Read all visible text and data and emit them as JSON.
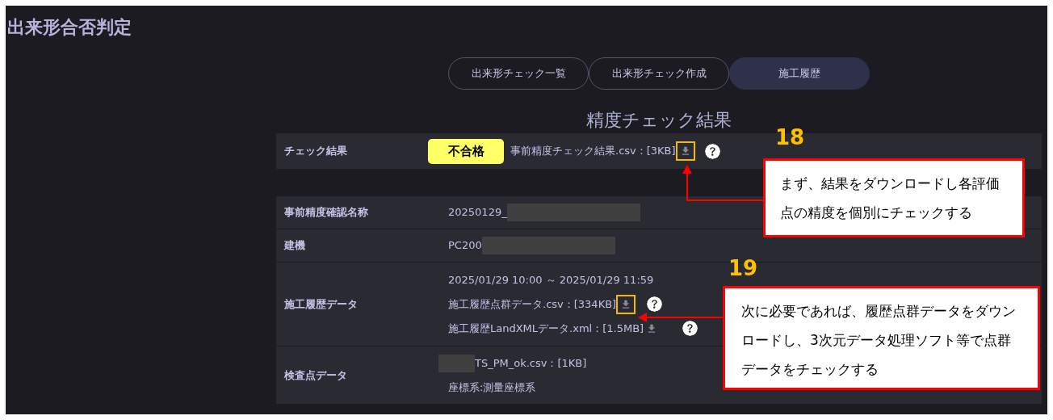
{
  "title": "出来形合否判定",
  "tabs": [
    {
      "label": "出来形チェック一覧",
      "selected": false
    },
    {
      "label": "出来形チェック作成",
      "selected": false
    },
    {
      "label": "施工履歴",
      "selected": true
    }
  ],
  "section_title": "精度チェック結果",
  "check_result": {
    "label": "チェック結果",
    "badge": "不合格",
    "file": "事前精度チェック結果.csv：[3KB]",
    "highlighted": true
  },
  "rows": [
    {
      "label": "事前精度確認名称",
      "lines": [
        {
          "kind": "text",
          "text": "20250129_",
          "redacted_after": true
        }
      ]
    },
    {
      "label": "建機",
      "lines": [
        {
          "kind": "text",
          "text": "PC200",
          "redacted_after": true
        }
      ]
    },
    {
      "label": "施工履歴データ",
      "lines": [
        {
          "kind": "text",
          "text": "2025/01/29 10:00 ～ 2025/01/29 11:59"
        },
        {
          "kind": "file",
          "text": "施工履歴点群データ.csv：[334KB]",
          "highlighted": true
        },
        {
          "kind": "file",
          "text": "施工履歴LandXMLデータ.xml：[1.5MB]",
          "highlighted": false
        }
      ]
    },
    {
      "label": "検査点データ",
      "lines": [
        {
          "kind": "text",
          "text": "TS_PM_ok.csv：[1KB]",
          "redacted_before": true
        },
        {
          "kind": "text",
          "text": "座標系:測量座標系"
        }
      ]
    }
  ],
  "callouts": [
    {
      "number": "18",
      "text": "まず、結果をダウンロードし各評価点の精度を個別にチェックする"
    },
    {
      "number": "19",
      "text": "次に必要であれば、履歴点群データをダウンロードし、3次元データ処理ソフト等で点群データをチェックする"
    }
  ]
}
